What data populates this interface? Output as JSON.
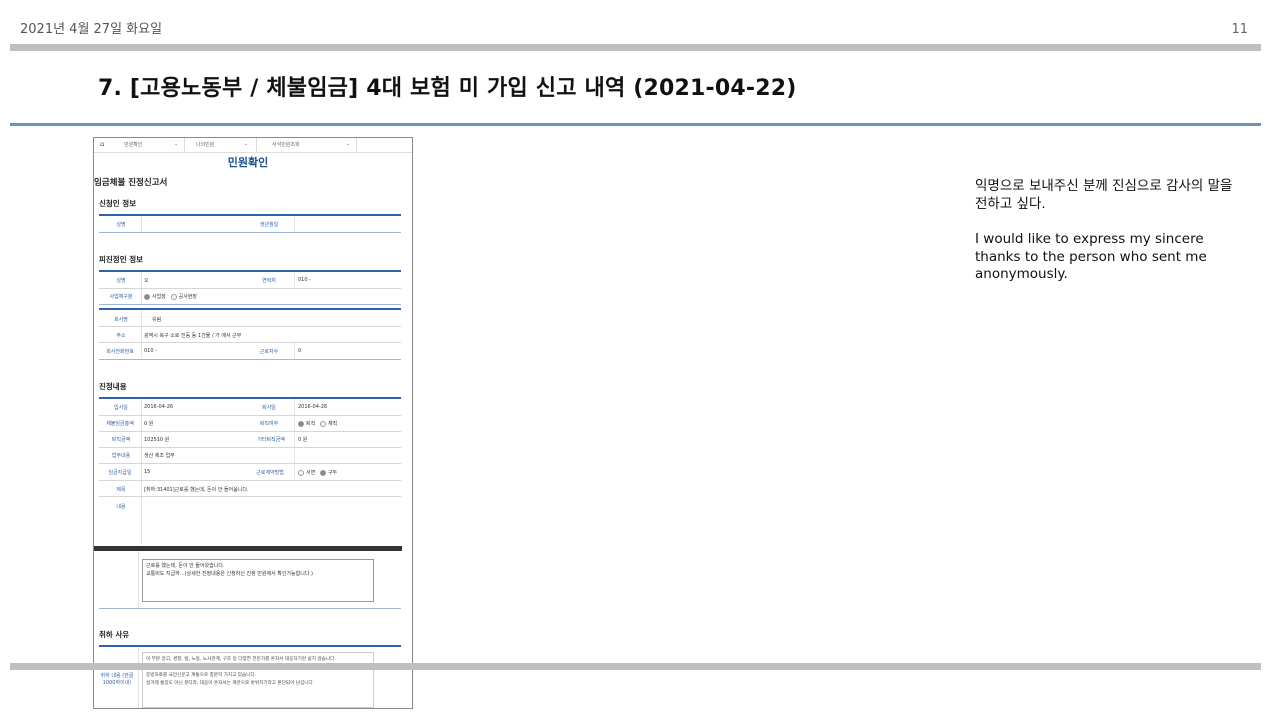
{
  "header": {
    "date": "2021년 4월 27일 화요일",
    "page_number": "11"
  },
  "slide_title": "7. [고용노동부 / 체불임금] 4대 보험 미 가입 신고 내역 (2021-04-22)",
  "note": {
    "korean": "익명으로 보내주신 분께 진심으로 감사의 말을 전하고 싶다.",
    "english": "I would like to express my sincere thanks to the person who sent me anonymously."
  },
  "screenshot": {
    "nav": [
      "민원확인",
      "나의민원",
      "서식민원조회"
    ],
    "page_title": "민원확인",
    "form_title": "임금체불 진정신고서",
    "applicant": {
      "section": "신청인 정보",
      "name_label": "성명",
      "name_value": "",
      "birth_label": "생년월일",
      "birth_value": ""
    },
    "respondent": {
      "section": "피진정인 정보",
      "name_label": "성명",
      "name_value": "오",
      "phone_label": "연락처",
      "phone_value": "010 -",
      "type_label": "사업체구분",
      "type_opt1": "사업장",
      "type_opt2": "공사현장",
      "company_label": "회사명",
      "company_value": "유림",
      "address_label": "주소",
      "address_value": "광역시 북구   소로 진등   동   1건물 / 가   에서 근무",
      "company_phone_label": "회사전화번호",
      "company_phone_value": "010 -",
      "workers_label": "근로자수",
      "workers_value": "0"
    },
    "details": {
      "section": "진정내용",
      "join_label": "입사일",
      "join_value": "2016-04-26",
      "leave_label": "퇴사일",
      "leave_value": "2016-04-28",
      "unpaid_label": "체불임금총액",
      "unpaid_value": "0 원",
      "retire_label": "퇴직여부",
      "retire_opt1": "퇴직",
      "retire_opt2": "재직",
      "severance_label": "퇴직금액",
      "severance_value": "102510 원",
      "other_label": "기타퇴직금액",
      "other_value": "0 원",
      "work_label": "업무내용",
      "work_value": "생산 제조 업무",
      "payday_label": "임금지급일",
      "payday_value": "15",
      "contract_label": "근로계약방법",
      "contract_opt1": "서면",
      "contract_opt2": "구두",
      "subject_label": "제목",
      "subject_value": "[취하:31401]근로를 했는데, 돈이 안 들어옵니다.",
      "content_label": "내용"
    },
    "box_text": [
      "근로를 했는데, 돈이 안 들어왔습니다.",
      "교통비도 지급하...(상세한 진정내용은 신청하신 진정 민원에서 확인가능합니다.)"
    ],
    "withdraw": {
      "section": "취하 사유",
      "label": "취하 내용 (한글1000자이내)",
      "lines": [
        "이 부분 알고, 경찰, 법, 노동, 노사관계, 구조 등 다양한 전문가를 혼자서 대응하기란 쉽지 않습니다.",
        "저방 노동청만 가지고는 대응하기가 어렵다고 판단되어 취하합니다.",
        "증빙자료를 국민신문고 계통으로 충분히 가지고 있습니다.",
        "실거래 통장도 아닌 분디라, 대응이 혼자서는 계란으로 바위치기라고 판단되어 남깁니다."
      ]
    }
  }
}
